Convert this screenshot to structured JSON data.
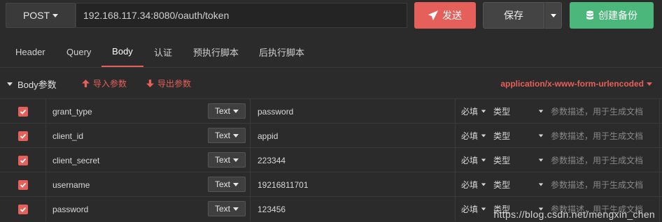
{
  "request": {
    "method": "POST",
    "url": "192.168.117.34:8080/oauth/token",
    "send_label": "发送",
    "save_label": "保存",
    "backup_label": "创建备份"
  },
  "tabs": [
    {
      "label": "Header"
    },
    {
      "label": "Query"
    },
    {
      "label": "Body"
    },
    {
      "label": "认证"
    },
    {
      "label": "预执行脚本"
    },
    {
      "label": "后执行脚本"
    }
  ],
  "body": {
    "section_title": "Body参数",
    "import_label": "导入参数",
    "export_label": "导出参数",
    "content_type": "application/x-www-form-urlencoded",
    "type_label": "Text",
    "required_label": "必填",
    "kind_label": "类型",
    "desc_placeholder": "参数描述，用于生成文档",
    "params": [
      {
        "key": "grant_type",
        "value": "password"
      },
      {
        "key": "client_id",
        "value": "appid"
      },
      {
        "key": "client_secret",
        "value": "223344"
      },
      {
        "key": "username",
        "value": "19216811701"
      },
      {
        "key": "password",
        "value": "123456"
      }
    ]
  },
  "watermark": "https://blog.csdn.net/mengxin_chen",
  "colors": {
    "accent": "#e5605a",
    "success": "#4cb77b",
    "bg": "#2b2b2b"
  }
}
